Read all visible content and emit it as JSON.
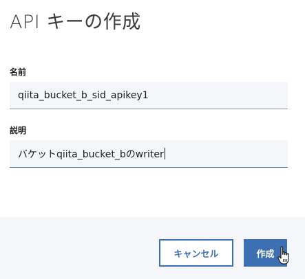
{
  "dialog": {
    "title": "API キーの作成"
  },
  "name_field": {
    "label": "名前",
    "value": "qiita_bucket_b_sid_apikey1"
  },
  "description_field": {
    "label": "説明",
    "value": "バケットqiita_bucket_bのwriter"
  },
  "footer": {
    "cancel_label": "キャンセル",
    "create_label": "作成"
  },
  "colors": {
    "accent": "#3d70b2",
    "field_background": "#f4f6fa",
    "footer_background": "#f4f6fa"
  },
  "icons": {
    "cursor": "hand-pointer-icon"
  }
}
